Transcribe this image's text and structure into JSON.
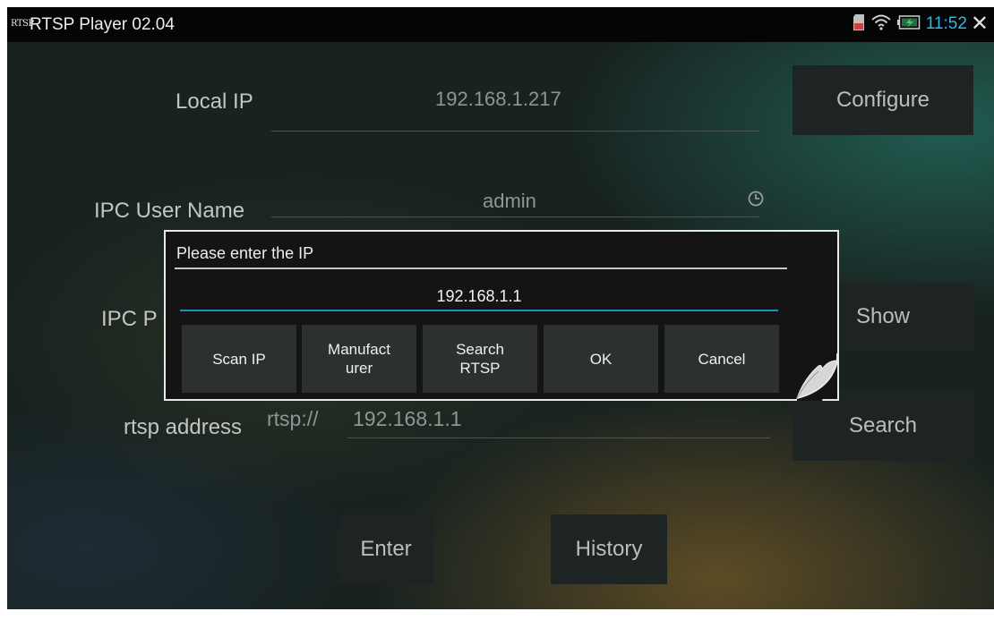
{
  "status_bar": {
    "logo_text": "RTSP",
    "app_title": "RTSP Player 02.04",
    "time": "11:52",
    "icons": [
      "sd-card-icon",
      "wifi-icon",
      "battery-charging-icon",
      "close-icon"
    ]
  },
  "form": {
    "local_ip": {
      "label": "Local IP",
      "value": "192.168.1.217"
    },
    "user_name": {
      "label": "IPC User Name",
      "value": "admin"
    },
    "password": {
      "label": "IPC P",
      "value": ""
    },
    "rtsp": {
      "label": "rtsp address",
      "prefix": "rtsp://",
      "value": "192.168.1.1"
    }
  },
  "buttons": {
    "configure": "Configure",
    "show": "Show",
    "search": "Search",
    "enter": "Enter",
    "history": "History"
  },
  "dialog": {
    "title": "Please enter the IP",
    "ip_value": "192.168.1.1",
    "buttons": {
      "scan_ip": "Scan IP",
      "manufacturer": "Manufact\nurer",
      "search_rtsp": "Search\nRTSP",
      "ok": "OK",
      "cancel": "Cancel"
    }
  },
  "colors": {
    "status_clock": "#33b5e5",
    "input_underline": "#1e93b6",
    "sd_card": "#d04040",
    "battery_charge": "#3bd16f"
  }
}
